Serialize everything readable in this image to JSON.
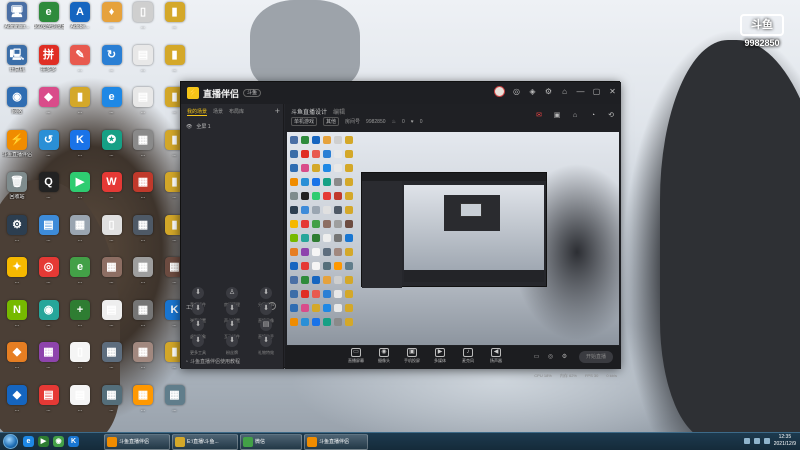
{
  "watermark": {
    "logo": "斗鱼",
    "room_number": "9982850"
  },
  "desktop_icons": [
    {
      "label": "Administr...",
      "glyph": "🖥",
      "color": "#4a6fa5"
    },
    {
      "label": "360安全浏览器",
      "glyph": "e",
      "color": "#2e8b3c"
    },
    {
      "label": "Adobe...",
      "glyph": "A",
      "color": "#1565c0"
    },
    {
      "label": "...",
      "glyph": "♦",
      "color": "#e6a23c"
    },
    {
      "label": "...",
      "glyph": "▯",
      "color": "#cfcfcf"
    },
    {
      "label": "...",
      "glyph": "▮",
      "color": "#d4a829"
    },
    {
      "label": "计算机",
      "glyph": "🖳",
      "color": "#3b6ea8"
    },
    {
      "label": "拼多多",
      "glyph": "拼",
      "color": "#e02e24"
    },
    {
      "label": "...",
      "glyph": "✎",
      "color": "#e85a4f"
    },
    {
      "label": "...",
      "glyph": "↻",
      "color": "#2a7fd4"
    },
    {
      "label": "...",
      "glyph": "▤",
      "color": "#e8e8e8"
    },
    {
      "label": "...",
      "glyph": "▮",
      "color": "#d4a829"
    },
    {
      "label": "网络",
      "glyph": "◉",
      "color": "#2f6db2"
    },
    {
      "label": "...",
      "glyph": "◆",
      "color": "#d94c8a"
    },
    {
      "label": "...",
      "glyph": "▮",
      "color": "#d4a829"
    },
    {
      "label": "...",
      "glyph": "e",
      "color": "#1e88e5"
    },
    {
      "label": "...",
      "glyph": "▤",
      "color": "#e8e8e8"
    },
    {
      "label": "...",
      "glyph": "▮",
      "color": "#d4a829"
    },
    {
      "label": "斗鱼直播伴侣",
      "glyph": "⚡",
      "color": "#f08c00"
    },
    {
      "label": "...",
      "glyph": "↺",
      "color": "#2a8fd6"
    },
    {
      "label": "...",
      "glyph": "K",
      "color": "#1a73e8"
    },
    {
      "label": "...",
      "glyph": "✪",
      "color": "#16a085"
    },
    {
      "label": "...",
      "glyph": "▦",
      "color": "#8a8a8a"
    },
    {
      "label": "...",
      "glyph": "▮",
      "color": "#d4a829"
    },
    {
      "label": "回收站",
      "glyph": "🗑",
      "color": "#7f8c8d"
    },
    {
      "label": "...",
      "glyph": "Q",
      "color": "#222"
    },
    {
      "label": "...",
      "glyph": "▶",
      "color": "#2ecc71"
    },
    {
      "label": "...",
      "glyph": "W",
      "color": "#e53935"
    },
    {
      "label": "...",
      "glyph": "▦",
      "color": "#c0392b"
    },
    {
      "label": "...",
      "glyph": "▮",
      "color": "#d4a829"
    },
    {
      "label": "...",
      "glyph": "⚙",
      "color": "#2c3e50"
    },
    {
      "label": "...",
      "glyph": "▤",
      "color": "#3d8bd9"
    },
    {
      "label": "...",
      "glyph": "▦",
      "color": "#9aa5b1"
    },
    {
      "label": "...",
      "glyph": "▯",
      "color": "#e0e0e0"
    },
    {
      "label": "...",
      "glyph": "▦",
      "color": "#4e5966"
    },
    {
      "label": "...",
      "glyph": "▮",
      "color": "#d4a829"
    },
    {
      "label": "...",
      "glyph": "✦",
      "color": "#f5b800"
    },
    {
      "label": "...",
      "glyph": "◎",
      "color": "#e53935"
    },
    {
      "label": "...",
      "glyph": "e",
      "color": "#43a047"
    },
    {
      "label": "...",
      "glyph": "▦",
      "color": "#8d6e63"
    },
    {
      "label": "...",
      "glyph": "▦",
      "color": "#9e9e9e"
    },
    {
      "label": "...",
      "glyph": "▦",
      "color": "#6d4c41"
    },
    {
      "label": "...",
      "glyph": "N",
      "color": "#76b900"
    },
    {
      "label": "...",
      "glyph": "◉",
      "color": "#26a69a"
    },
    {
      "label": "...",
      "glyph": "+",
      "color": "#2e7d32"
    },
    {
      "label": "...",
      "glyph": "▤",
      "color": "#eeeeee"
    },
    {
      "label": "...",
      "glyph": "▦",
      "color": "#757575"
    },
    {
      "label": "...",
      "glyph": "K",
      "color": "#1976d2"
    },
    {
      "label": "...",
      "glyph": "◆",
      "color": "#e67e22"
    },
    {
      "label": "...",
      "glyph": "▦",
      "color": "#8e44ad"
    },
    {
      "label": "...",
      "glyph": "▯",
      "color": "#f5f5f5"
    },
    {
      "label": "...",
      "glyph": "▦",
      "color": "#5d6d7e"
    },
    {
      "label": "...",
      "glyph": "▦",
      "color": "#a1887f"
    },
    {
      "label": "...",
      "glyph": "▮",
      "color": "#d4a829"
    },
    {
      "label": "...",
      "glyph": "◆",
      "color": "#1565c0"
    },
    {
      "label": "...",
      "glyph": "▤",
      "color": "#e53935"
    },
    {
      "label": "...",
      "glyph": "▤",
      "color": "#f5f5f5"
    },
    {
      "label": "...",
      "glyph": "▦",
      "color": "#546e7a"
    },
    {
      "label": "...",
      "glyph": "▦",
      "color": "#ff9800"
    },
    {
      "label": "...",
      "glyph": "▦",
      "color": "#607d8b"
    }
  ],
  "app": {
    "logo_glyph": "⚡",
    "name": "直播伴侣",
    "badge": "斗鱼",
    "titlebar_icons": [
      "◎",
      "◈",
      "⚙",
      "⌂",
      "—",
      "▢",
      "✕"
    ],
    "left_tabs": [
      {
        "label": "我的场景",
        "active": true
      },
      {
        "label": "场景",
        "active": false
      },
      {
        "label": "布局库",
        "active": false
      }
    ],
    "scene": {
      "eye_glyph": "👁",
      "label": "全屏 1",
      "add": "+"
    },
    "tools_title": "工具箱",
    "tools_more": "⋯",
    "tools": [
      {
        "glyph": "⬇",
        "label": "音频插件"
      },
      {
        "glyph": "♙",
        "label": "房间管理"
      },
      {
        "glyph": "⬇",
        "label": "分屏调节"
      },
      {
        "glyph": "⬇",
        "label": "弹幕设置"
      },
      {
        "glyph": "⬇",
        "label": "声卡设置"
      },
      {
        "glyph": "⬇",
        "label": "直播录像"
      },
      {
        "glyph": "⬇",
        "label": "虚拟形象"
      },
      {
        "glyph": "⬇",
        "label": "互动插件"
      },
      {
        "glyph": "▤",
        "label": "直播助手"
      },
      {
        "glyph": "⬇",
        "label": "更多工具"
      },
      {
        "glyph": "⬇",
        "label": "粉丝牌"
      },
      {
        "glyph": "⬇",
        "label": "礼物特效"
      }
    ],
    "footer_text": "斗鱼直播伴侣使用教程",
    "room": {
      "title": "斗鱼直播设计",
      "edit": "编辑",
      "category_chip": "单机游戏",
      "sub_chip": "其他",
      "room_label": "房间号",
      "room_id": "9982850",
      "viewers": "0",
      "followers": "0"
    },
    "top_icons": [
      "✉",
      "▣",
      "⌂",
      "◔",
      "⟲"
    ],
    "controls": [
      {
        "glyph": "▭",
        "label": "直播屏幕"
      },
      {
        "glyph": "◉",
        "label": "摄像头"
      },
      {
        "glyph": "▣",
        "label": "手机投屏"
      },
      {
        "glyph": "▶",
        "label": "多媒体"
      },
      {
        "glyph": "♪",
        "label": "麦克风"
      },
      {
        "glyph": "◀",
        "label": "扬声器"
      }
    ],
    "start_button": "开始直播",
    "status": [
      "CPU 18%",
      "内存 62%",
      "FPS 30",
      "0 kb/s"
    ]
  },
  "taskbar": {
    "quick_icons": [
      {
        "glyph": "e",
        "color": "#1e88e5"
      },
      {
        "glyph": "▶",
        "color": "#2e7d32"
      },
      {
        "glyph": "◉",
        "color": "#43a047"
      },
      {
        "glyph": "K",
        "color": "#1976d2"
      }
    ],
    "tasks": [
      {
        "label": "斗鱼直播伴侣",
        "color": "#f08c00"
      },
      {
        "label": "E:\\直播\\斗鱼...",
        "color": "#d4a829"
      },
      {
        "label": "微信",
        "color": "#43a047"
      },
      {
        "label": "斗鱼直播伴侣",
        "color": "#f08c00"
      }
    ],
    "time": "12:35",
    "date": "2021/12/9"
  }
}
